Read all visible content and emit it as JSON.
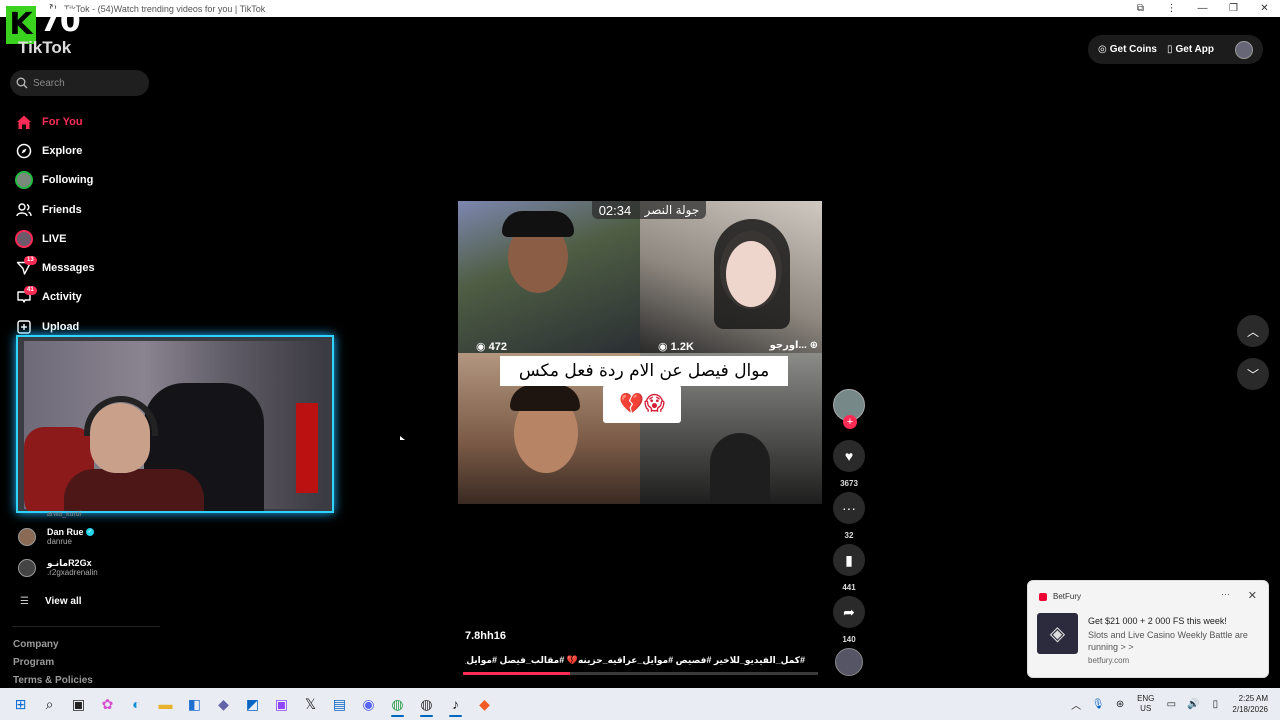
{
  "browser": {
    "title": "TikTok - (54)Watch trending videos for you | TikTok"
  },
  "overlay": {
    "logo_letter": "K",
    "logo_number": "70"
  },
  "brand": {
    "name": "TikTok"
  },
  "search": {
    "placeholder": "Search"
  },
  "nav": [
    {
      "label": "For You",
      "icon": "home-icon",
      "badge": ""
    },
    {
      "label": "Explore",
      "icon": "compass-icon",
      "badge": ""
    },
    {
      "label": "Following",
      "icon": "following-avatar-icon",
      "badge": ""
    },
    {
      "label": "Friends",
      "icon": "friends-icon",
      "badge": ""
    },
    {
      "label": "LIVE",
      "icon": "live-icon",
      "badge": ""
    },
    {
      "label": "Messages",
      "icon": "messages-icon",
      "badge": "13"
    },
    {
      "label": "Activity",
      "icon": "activity-icon",
      "badge": "41"
    },
    {
      "label": "Upload",
      "icon": "upload-icon",
      "badge": ""
    }
  ],
  "following_accounts": {
    "cut_handle": "arwa_kurdi",
    "items": [
      {
        "name": "Dan Rue",
        "handle": "danrue",
        "verified": true
      },
      {
        "name": "مانـوR2Gx",
        "handle": ".r2gxadrenalin",
        "verified": false
      }
    ],
    "view_all": "View all"
  },
  "footer": {
    "links": [
      "Company",
      "Program",
      "Terms & Policies"
    ]
  },
  "header": {
    "get_coins": "Get Coins",
    "get_app": "Get App"
  },
  "video": {
    "top_label_time": "02:34",
    "top_label_text": "جولة النصر",
    "stat_left": "472",
    "stat_right": "1.2K",
    "stat_right_name": "اورجو...",
    "caption": "موال فيصل عن الام ردة فعل مكس",
    "caption_emoji": "💔😱",
    "author": "7.8hh16",
    "tags": "#كمل_الفيديو_للاخير #فصيص #موايل_عراقيه_حزينه💔 #مقالب_فيصل #موايل_حزينه",
    "progress": 0.3
  },
  "actions": {
    "likes": "3673",
    "comments": "32",
    "saves": "441",
    "shares": "140"
  },
  "notification": {
    "app": "BetFury",
    "more": "···",
    "title": "Get $21 000 + 2 000 FS this week!",
    "body": "Slots and Live Casino Weekly Battle are running > >",
    "url": "betfury.com"
  },
  "taskbar": {
    "apps": [
      "windows-start-icon",
      "search-icon",
      "task-view-icon",
      "copilot-icon",
      "edge-icon",
      "file-explorer-icon",
      "store-icon",
      "teams-icon",
      "outlook-icon",
      "twitch-icon",
      "x-icon",
      "linkedin-icon",
      "discord-icon",
      "chrome-icon",
      "chrome-alt-icon",
      "tiktok-icon",
      "brave-icon"
    ],
    "lang_top": "ENG",
    "lang_bottom": "US",
    "time": "2:25 AM",
    "date": "2/18/2026"
  },
  "colors": {
    "accent": "#fe2c55",
    "background": "#000000",
    "cam_border": "#2fd3ff"
  }
}
